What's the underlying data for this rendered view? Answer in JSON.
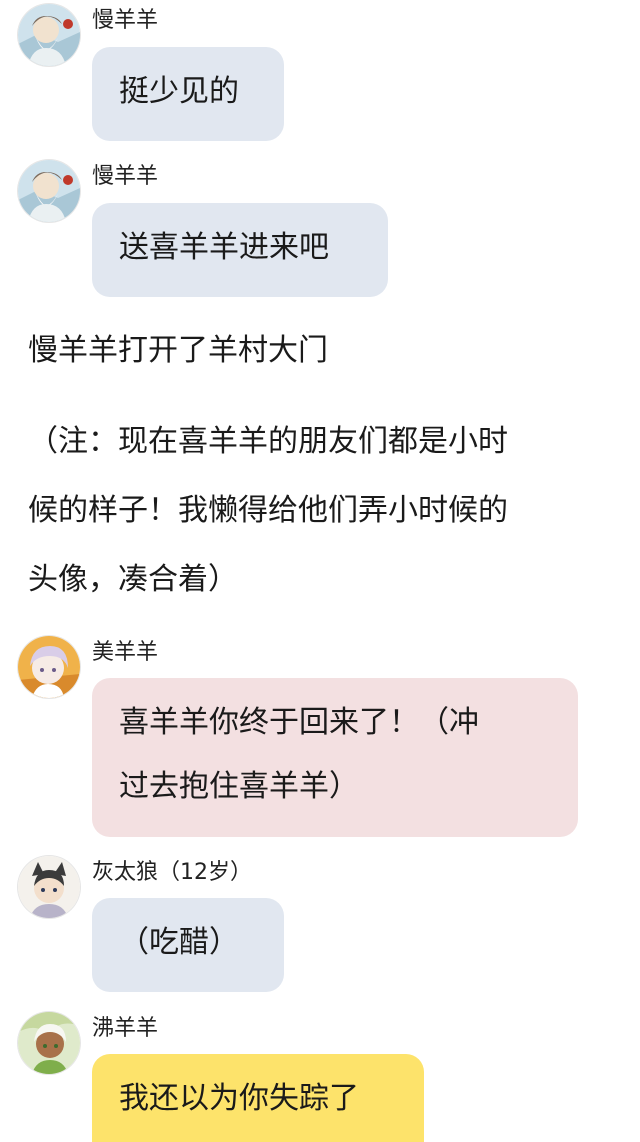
{
  "messages": [
    {
      "sender": "慢羊羊",
      "text": "挺少见的"
    },
    {
      "sender": "慢羊羊",
      "text": "送喜羊羊进来吧"
    },
    {
      "sender": "美羊羊",
      "lines": [
        "喜羊羊你终于回来了！（冲",
        "过去抱住喜羊羊）"
      ]
    },
    {
      "sender": "灰太狼（12岁）",
      "text": "（吃醋）"
    },
    {
      "sender": "沸羊羊",
      "text": "我还以为你失踪了"
    }
  ],
  "narration": {
    "line1": "慢羊羊打开了羊村大门",
    "note_lines": [
      "（注：现在喜羊羊的朋友们都是小时",
      "候的样子！我懒得给他们弄小时候的",
      "头像，凑合着）"
    ]
  },
  "colors": {
    "bubble_default": "#e1e7f0",
    "bubble_pink": "#f3e0e1",
    "bubble_yellow": "#fde36b"
  },
  "avatars": [
    "elder-sheep-avatar",
    "elder-sheep-avatar",
    "pink-hair-girl-avatar",
    "cat-ear-boy-avatar",
    "white-hair-boy-avatar"
  ]
}
